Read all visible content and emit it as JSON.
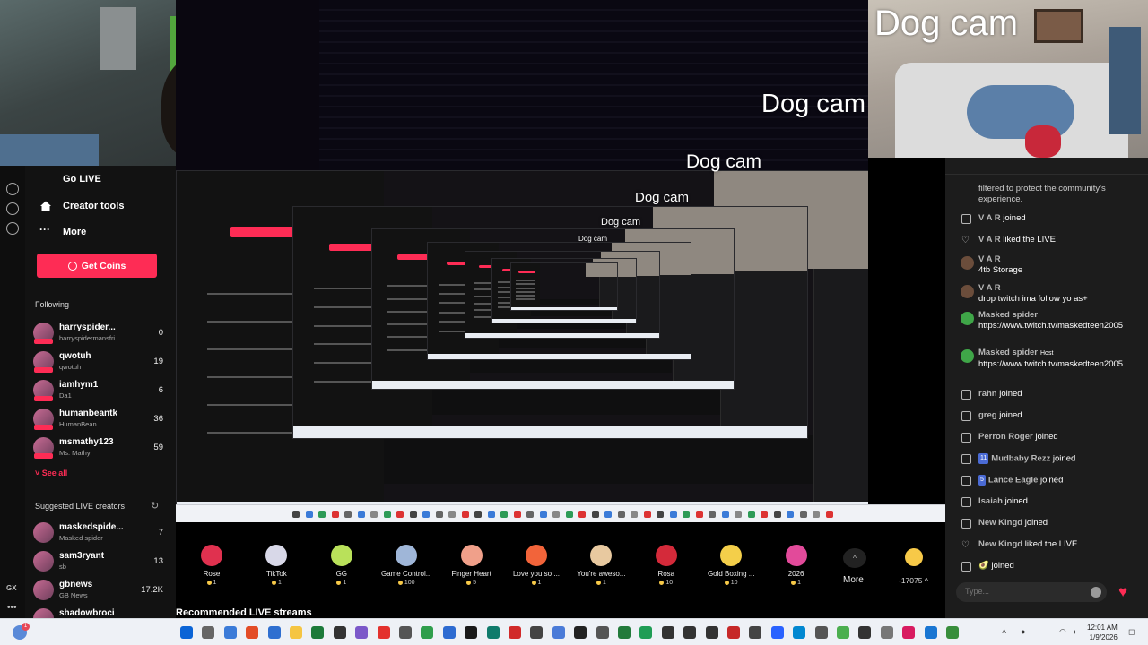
{
  "sidebar": {
    "go_live": "Go LIVE",
    "creator_tools": "Creator tools",
    "more": "More",
    "get_coins": "Get Coins",
    "following_title": "Following",
    "following": [
      {
        "name": "harryspider...",
        "sub": "harryspidermansfri...",
        "count": "0"
      },
      {
        "name": "qwotuh",
        "sub": "qwotuh",
        "count": "19"
      },
      {
        "name": "iamhym1",
        "sub": "Da1",
        "count": "6"
      },
      {
        "name": "humanbeantk",
        "sub": "HumanBean",
        "count": "36"
      },
      {
        "name": "msmathy123",
        "sub": "Ms. Mathy",
        "count": "59"
      }
    ],
    "see_all": "See all",
    "suggested_title": "Suggested LIVE creators",
    "suggested": [
      {
        "name": "maskedspide...",
        "sub": "Masked spider",
        "count": "7"
      },
      {
        "name": "sam3ryant",
        "sub": "sb",
        "count": "13"
      },
      {
        "name": "gbnews",
        "sub": "GB News",
        "count": "17.2K"
      },
      {
        "name": "shadowbroci",
        "sub": "",
        "count": ""
      }
    ],
    "rail_gx": "GX"
  },
  "stream": {
    "title": "Dog cam",
    "recommended": "Recommended LIVE streams"
  },
  "gifts": [
    {
      "name": "Rose",
      "price": "1",
      "color": "#e0314f"
    },
    {
      "name": "TikTok",
      "price": "1",
      "color": "#d8d8e8"
    },
    {
      "name": "GG",
      "price": "1",
      "color": "#b9e15a"
    },
    {
      "name": "Game Control...",
      "price": "100",
      "color": "#9fb6d8"
    },
    {
      "name": "Finger Heart",
      "price": "5",
      "color": "#f0a08a"
    },
    {
      "name": "Love you so ...",
      "price": "1",
      "color": "#f2643a"
    },
    {
      "name": "You're aweso...",
      "price": "1",
      "color": "#e8c9a0"
    },
    {
      "name": "Rosa",
      "price": "10",
      "color": "#d42a3a"
    },
    {
      "name": "Gold Boxing ...",
      "price": "10",
      "color": "#f4cf4a"
    },
    {
      "name": "2026",
      "price": "1",
      "color": "#e24a9a"
    }
  ],
  "gift_more": "More",
  "gift_more_arrow": "^",
  "coin_balance": "-17075 ^",
  "chat": {
    "top_text": "filtered to protect the community's experience.",
    "messages": [
      {
        "kind": "join",
        "user": "V A R",
        "text": "joined"
      },
      {
        "kind": "heart",
        "user": "V A R",
        "text": "liked the LIVE"
      },
      {
        "kind": "msg",
        "user": "V A R",
        "text": "4tb Storage"
      },
      {
        "kind": "msg",
        "user": "V A R",
        "text": "drop twitch ima follow yo as+"
      },
      {
        "kind": "msg-green",
        "user": "Masked spider",
        "host": "",
        "text": "https://www.twitch.tv/maskedteen2005"
      },
      {
        "kind": "msg-green",
        "user": "Masked spider",
        "host": "Host",
        "text": "https://www.twitch.tv/maskedteen2005"
      },
      {
        "kind": "join",
        "user": "rahn",
        "text": "joined"
      },
      {
        "kind": "join",
        "user": "greg",
        "text": "joined"
      },
      {
        "kind": "join",
        "user": "Perron Roger",
        "text": "joined"
      },
      {
        "kind": "join",
        "badge": "11",
        "user": "Mudbaby Rezz",
        "text": "joined"
      },
      {
        "kind": "join",
        "badge": "5",
        "user": "Lance Eagle",
        "text": "joined"
      },
      {
        "kind": "join",
        "user": "Isaiah",
        "text": "joined"
      },
      {
        "kind": "join",
        "user": "New Kingd",
        "text": "joined"
      },
      {
        "kind": "heart",
        "user": "New Kingd",
        "text": "liked the LIVE"
      },
      {
        "kind": "join",
        "user": "🥑",
        "text": "joined"
      }
    ],
    "input_placeholder": "Type..."
  },
  "taskbar": {
    "time": "12:01 AM",
    "date": "1/9/2026",
    "notif": "1"
  },
  "colors": {
    "accent": "#fe2c55",
    "bg": "#000000",
    "panel": "#1c1c1c"
  }
}
